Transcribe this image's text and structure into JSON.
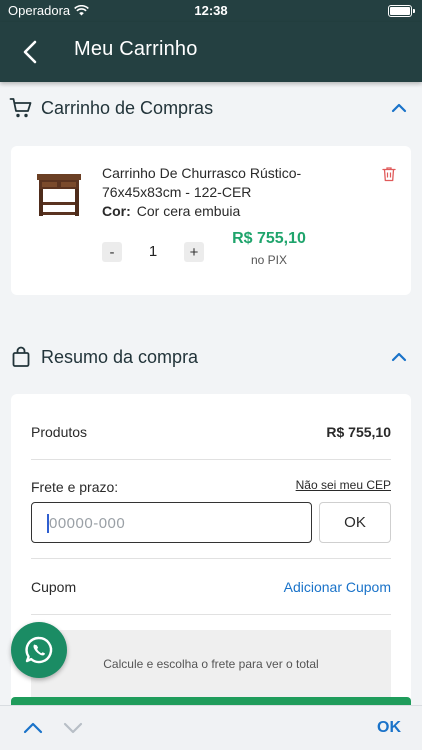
{
  "status_bar": {
    "carrier": "Operadora",
    "time": "12:38"
  },
  "header": {
    "title": "Meu Carrinho"
  },
  "cart_section": {
    "title": "Carrinho de Compras"
  },
  "cart_item": {
    "name": "Carrinho De Churrasco Rústico-76x45x83cm - 122-CER",
    "color_label": "Cor:",
    "color_value": "Cor cera embuia",
    "minus_label": "-",
    "plus_label": "+",
    "quantity": "1",
    "price": "R$ 755,10",
    "price_note": "no PIX"
  },
  "summary_section": {
    "title": "Resumo da compra"
  },
  "summary": {
    "products_label": "Produtos",
    "products_value": "R$ 755,10",
    "shipping_label": "Frete e prazo:",
    "no_cep_link": "Não sei meu CEP",
    "cep_placeholder": "00000-000",
    "ok_label": "OK",
    "coupon_label": "Cupom",
    "add_coupon_link": "Adicionar Cupom",
    "shipping_hint": "Calcule e escolha o frete para ver o total"
  },
  "keyboard_toolbar": {
    "done_label": "OK"
  },
  "colors": {
    "header_bg": "#244041",
    "price_green": "#1fa46c",
    "link_blue": "#1a73c9",
    "checkout_green": "#1f9c5b",
    "whatsapp_green": "#1b8c64"
  }
}
